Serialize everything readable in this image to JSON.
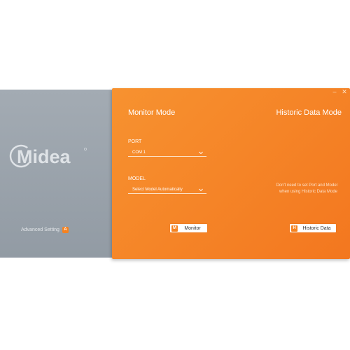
{
  "left": {
    "brand": "Midea",
    "advanced_setting": "Advanced Setting",
    "advanced_badge": "A"
  },
  "window": {
    "minimize_glyph": "–",
    "close_glyph": "✕"
  },
  "monitor_mode": {
    "title": "Monitor Mode",
    "port_label": "PORT",
    "port_value": "COM 1",
    "model_label": "MODEL",
    "model_value": "Select Model Automatically",
    "button_label": "Monitor",
    "button_badge": "M"
  },
  "historic_mode": {
    "title": "Historic Data Mode",
    "note_line1": "Don't need to set Port and Model",
    "note_line2": "when using Historic Data Mode",
    "button_label": "Historic Data",
    "button_badge": "H"
  },
  "colors": {
    "accent": "#f58220",
    "panel_gray": "#9aa3ab"
  }
}
